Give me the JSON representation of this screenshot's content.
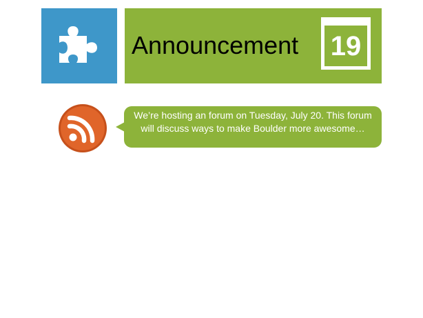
{
  "header": {
    "title": "Announcement",
    "calendar_day": "19"
  },
  "announcement": {
    "text": "We’re hosting an forum on Tuesday, July 20. This forum will discuss ways to make Boulder more awesome…"
  },
  "icons": {
    "puzzle": "puzzle-piece-icon",
    "calendar": "calendar-icon",
    "rss": "rss-feed-icon"
  },
  "colors": {
    "puzzle_tile": "#3e97c9",
    "accent_green": "#8db33a",
    "rss_orange": "#e0652a",
    "text_dark": "#000000",
    "text_light": "#ffffff"
  }
}
